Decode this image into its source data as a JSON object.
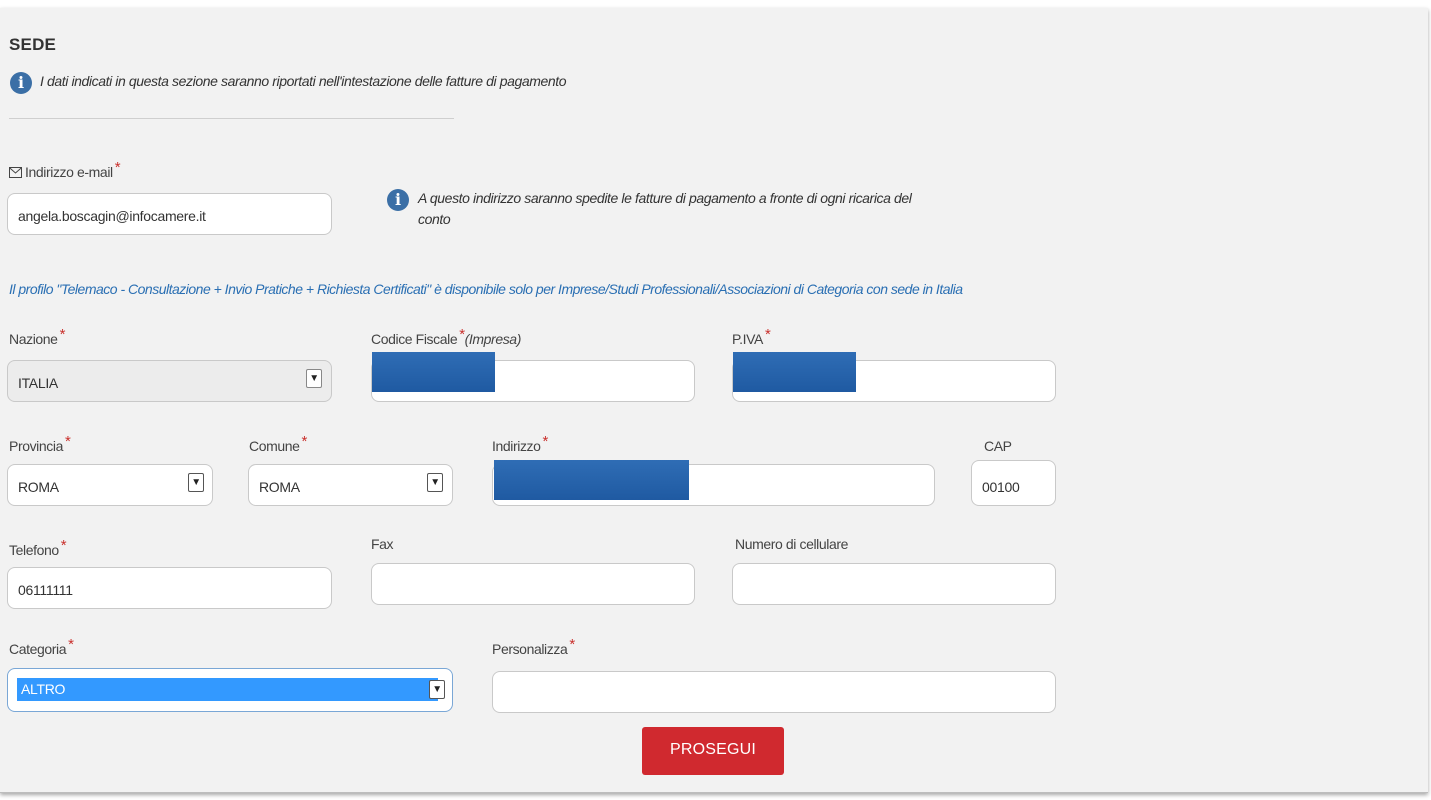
{
  "section": {
    "title": "SEDE",
    "info_note": "I dati indicati in questa sezione saranno riportati nell'intestazione delle fatture di pagamento"
  },
  "email": {
    "label": "Indirizzo e-mail",
    "value": "angela.boscagin@infocamere.it",
    "note_line1": "A questo indirizzo saranno spedite le fatture di pagamento a fronte di ogni ricarica del",
    "note_line2": "conto"
  },
  "profile_note": "Il profilo \"Telemaco - Consultazione + Invio Pratiche + Richiesta Certificati\" è disponibile solo per Imprese/Studi Professionali/Associazioni di Categoria con sede in Italia",
  "required_mark": "*",
  "fields": {
    "nazione": {
      "label": "Nazione",
      "value": "ITALIA"
    },
    "codice_fiscale": {
      "label": "Codice Fiscale",
      "qualifier": "(Impresa)",
      "value": ""
    },
    "piva": {
      "label": "P.IVA",
      "value": ""
    },
    "provincia": {
      "label": "Provincia",
      "value": "ROMA"
    },
    "comune": {
      "label": "Comune",
      "value": "ROMA"
    },
    "indirizzo": {
      "label": "Indirizzo",
      "value": ""
    },
    "cap": {
      "label": "CAP",
      "value": "00100"
    },
    "telefono": {
      "label": "Telefono",
      "value": "06111111"
    },
    "fax": {
      "label": "Fax",
      "value": ""
    },
    "cellulare": {
      "label": "Numero di cellulare",
      "value": ""
    },
    "categoria": {
      "label": "Categoria",
      "value": "ALTRO"
    },
    "personalizza": {
      "label": "Personalizza",
      "value": ""
    }
  },
  "icons": {
    "info": "info-icon",
    "email": "envelope-icon",
    "dropdown": "chevron-down-icon"
  },
  "colors": {
    "accent_blue": "#2a6fb3",
    "required_red": "#c9302c",
    "button_red": "#d0292f",
    "selection_blue": "#3399ff"
  },
  "actions": {
    "submit_label": "PROSEGUI"
  }
}
